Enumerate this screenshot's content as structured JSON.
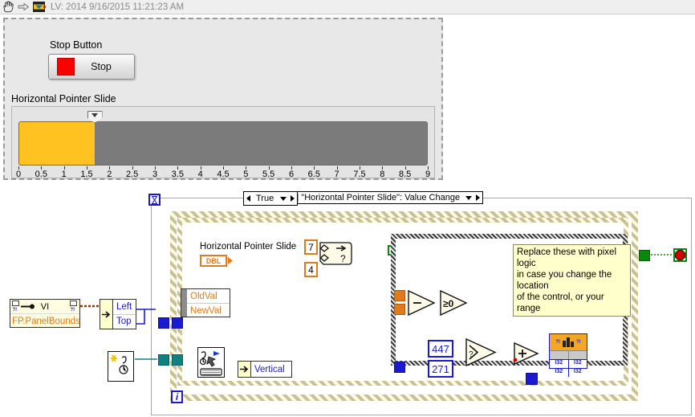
{
  "titlebar": {
    "text": "LV: 2014 9/16/2015 11:21:23 AM",
    "icons": [
      "hand-cursor-icon",
      "right-arrow-icon",
      "labview-vi-icon"
    ]
  },
  "front_panel": {
    "stop_button": {
      "label": "Stop Button",
      "caption": "Stop",
      "led_color": "#fd0000"
    },
    "slider": {
      "label": "Horizontal Pointer Slide",
      "value": 1.65,
      "min": 0,
      "max": 9,
      "tick_step": 0.5,
      "fill_color": "#ffc220",
      "track_color": "#7b7b7b",
      "tick_labels": [
        "0",
        "0.5",
        "1",
        "1.5",
        "2",
        "2.5",
        "3",
        "3.5",
        "4",
        "4.5",
        "5",
        "5.5",
        "6",
        "6.5",
        "7",
        "7.5",
        "8",
        "8.5",
        "9"
      ]
    }
  },
  "block_diagram": {
    "loop_iteration_label": "i",
    "event_structure": {
      "case_label": "[1] \"Horizontal Pointer Slide\": Value Change",
      "timeout_icon": "hourglass-icon",
      "event_data_node": {
        "fields": [
          "OldVal",
          "NewVal"
        ]
      }
    },
    "control_terminal": {
      "label": "Horizontal Pointer Slide",
      "datatype": "DBL"
    },
    "constants": {
      "upper_bound": "7",
      "lower_bound": "4",
      "x_constant": "447",
      "y_constant": "271"
    },
    "functions": {
      "in_range_and_coerce": "in-range-and-coerce-icon",
      "subtract": "subtract-icon",
      "greater_than_zero": "greater-than-zero-icon",
      "select": "select-icon",
      "add": "add-icon",
      "set_cursor_position": "set-cursor-position-icon",
      "cursor_position_unbundle": "cursor-position-icon"
    },
    "case_structure": {
      "case_label": "True"
    },
    "comment": {
      "line1": "Replace these with pixel logic",
      "line2": "in case you change the location",
      "line3": "of the control, or your range"
    },
    "property_node": {
      "object": "VI",
      "property": "FP.PanelBounds"
    },
    "unbundle_bounds": {
      "fields": [
        "Left",
        "Top"
      ]
    },
    "unbundle_cursor": {
      "fields": [
        "Vertical"
      ]
    },
    "cursor_data_types": [
      "I32",
      "I32",
      "I32",
      "I32"
    ],
    "stop_terminal": "stop-button-terminal"
  }
}
